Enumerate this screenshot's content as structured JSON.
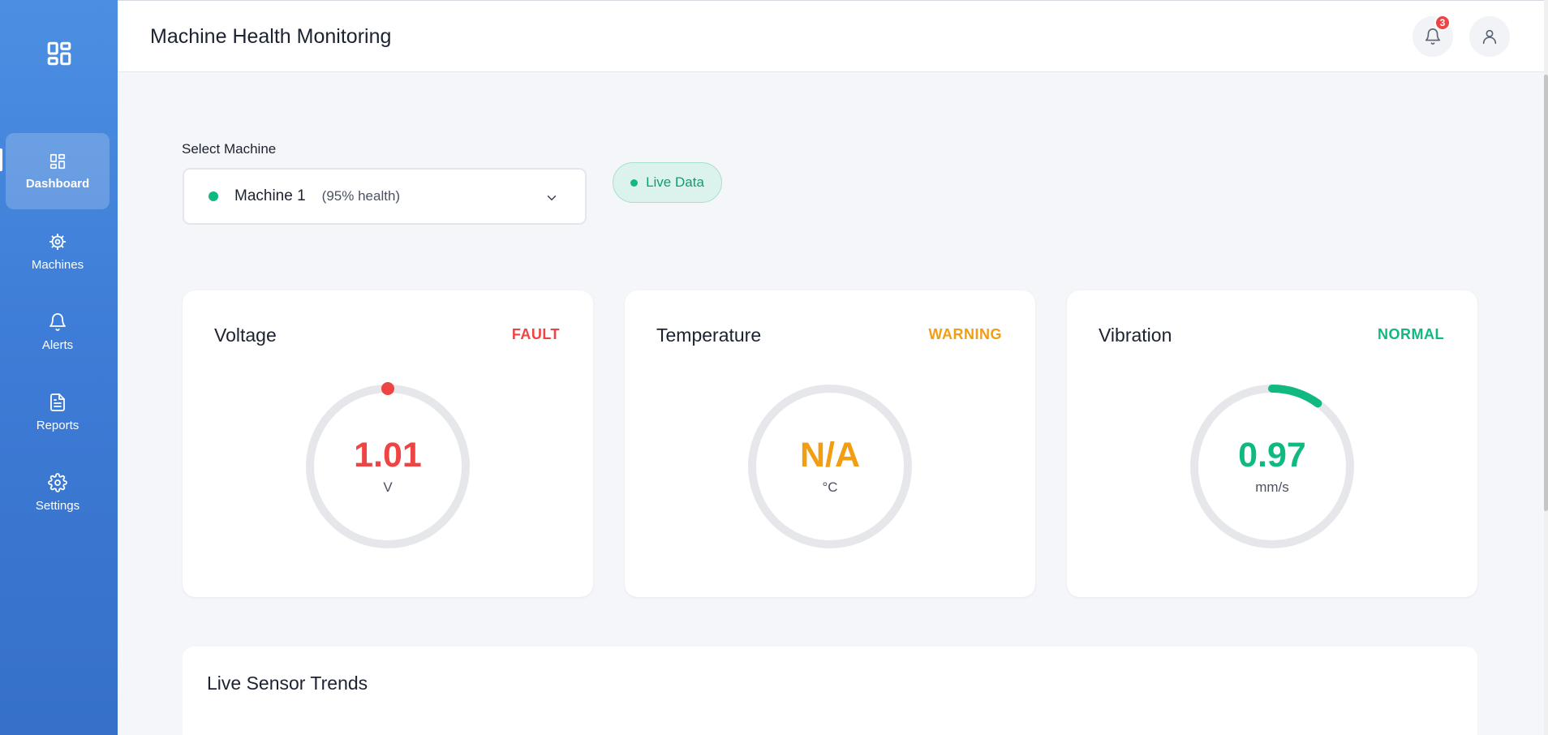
{
  "sidebar": {
    "logo_icon": "dashboard-grid-icon",
    "items": [
      {
        "label": "Dashboard",
        "icon": "dashboard-grid-icon",
        "active": true
      },
      {
        "label": "Machines",
        "icon": "cog-icon",
        "active": false
      },
      {
        "label": "Alerts",
        "icon": "bell-icon",
        "active": false
      },
      {
        "label": "Reports",
        "icon": "document-icon",
        "active": false
      },
      {
        "label": "Settings",
        "icon": "settings-gear-icon",
        "active": false
      }
    ]
  },
  "header": {
    "title": "Machine Health Monitoring",
    "notifications": {
      "icon": "bell-icon",
      "count": "3"
    },
    "profile_icon": "user-icon"
  },
  "machine_selector": {
    "label": "Select Machine",
    "selected_name": "Machine 1",
    "selected_health": "(95% health)",
    "status_color": "#10b981"
  },
  "live_indicator": {
    "label": "Live Data",
    "color": "#0e9f6e"
  },
  "metrics": [
    {
      "title": "Voltage",
      "status": "FAULT",
      "value": "1.01",
      "unit": "V",
      "color": "#ef4444",
      "arc_fraction": 0.0
    },
    {
      "title": "Temperature",
      "status": "WARNING",
      "value": "N/A",
      "unit": "°C",
      "color": "#f29d12",
      "arc_fraction": 0.0
    },
    {
      "title": "Vibration",
      "status": "NORMAL",
      "value": "0.97",
      "unit": "mm/s",
      "color": "#10b981",
      "arc_fraction": 0.1
    }
  ],
  "trends": {
    "title": "Live Sensor Trends"
  },
  "colors": {
    "accent": "#3d7bd6",
    "track": "#e6e7ea"
  }
}
